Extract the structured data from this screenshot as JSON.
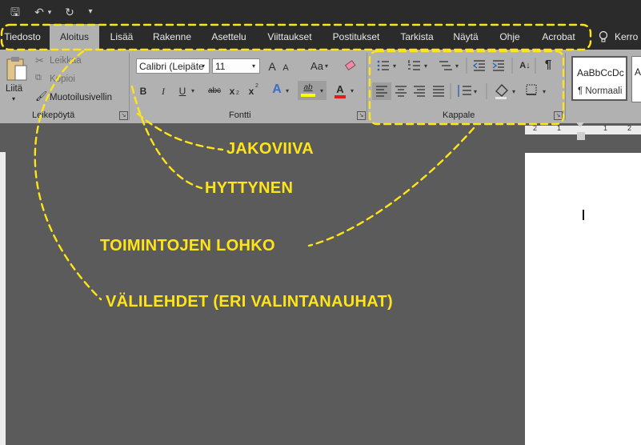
{
  "quick_access": {
    "save": "🖫",
    "undo": "↶",
    "undo_dd": "▾",
    "redo": "↻",
    "customize": "▾"
  },
  "tabs": [
    {
      "label": "Tiedosto"
    },
    {
      "label": "Aloitus"
    },
    {
      "label": "Lisää"
    },
    {
      "label": "Rakenne"
    },
    {
      "label": "Asettelu"
    },
    {
      "label": "Viittaukset"
    },
    {
      "label": "Postitukset"
    },
    {
      "label": "Tarkista"
    },
    {
      "label": "Näytä"
    },
    {
      "label": "Ohje"
    },
    {
      "label": "Acrobat"
    }
  ],
  "tell_me": {
    "icon": "lightbulb-icon",
    "label": "Kerro"
  },
  "clipboard": {
    "paste_label": "Liitä",
    "paste_dd": "▾",
    "cut": "Leikkaa",
    "copy": "Kopioi",
    "format_painter": "Muotoilusivellin",
    "group": "Leikepöytä"
  },
  "font": {
    "name": "Calibri (Leipäte",
    "size": "11",
    "grow": "A",
    "shrink": "A",
    "case": "Aa",
    "bold": "B",
    "italic": "I",
    "underline": "U",
    "strike": "abc",
    "subscript": "x",
    "superscript": "x",
    "sub_mark": "2",
    "sup_mark": "2",
    "effects": "A",
    "highlight": "ab",
    "color": "A",
    "group": "Fontti"
  },
  "paragraph": {
    "group": "Kappale",
    "pilcrow": "¶",
    "sort": "A↓"
  },
  "styles": {
    "sample": "AaBbCcDc",
    "name": "¶ Normaali",
    "next_sample": "A"
  },
  "ruler": {
    "marks": [
      "2",
      "1",
      "1",
      "2"
    ]
  },
  "annotations": {
    "divider": "JAKOVIIVA",
    "cursor": "HYTTYNEN",
    "group": "TOIMINTOJEN LOHKO",
    "tabs": "VÄLILEHDET (ERI VALINTANAUHAT)"
  },
  "colors": {
    "annotation": "#ffe419",
    "tab_bar": "#2b2b2b",
    "ribbon": "#b1b1b1",
    "workspace": "#5b5b5b"
  }
}
